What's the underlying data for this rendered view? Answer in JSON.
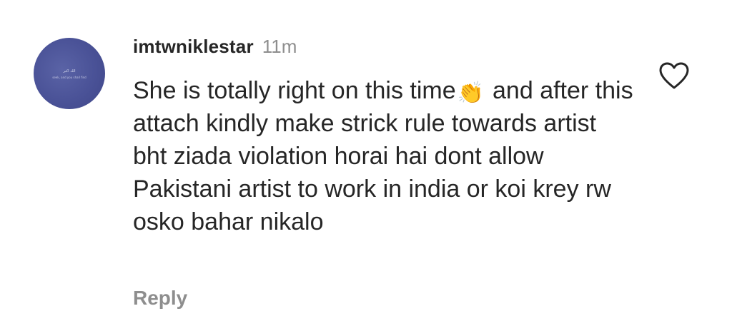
{
  "comment": {
    "avatar": {
      "line1": "اللہ اکبر",
      "line2": "seek, and you shall find"
    },
    "username": "imtwniklestar",
    "timestamp": "11m",
    "text_part1": "She is totally right on this time",
    "emoji": "👏",
    "text_part2": "and after this attach kindly make strick rule towards artist bht ziada violation horai hai dont allow Pakistani artist to work in india or koi krey rw osko bahar nikalo",
    "reply_label": "Reply",
    "like_icon": "heart-outline"
  }
}
